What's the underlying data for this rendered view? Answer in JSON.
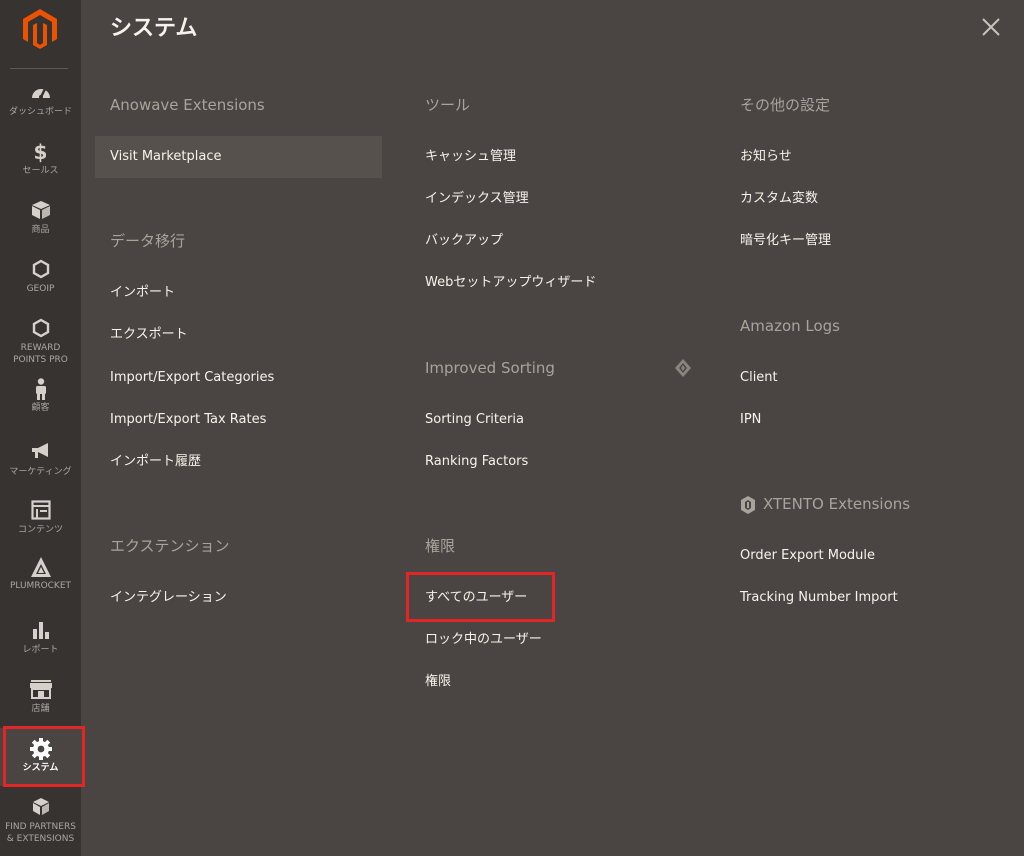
{
  "sidebar": {
    "items": [
      {
        "label": "ダッシュボード",
        "icon": "dashboard-gauge-icon"
      },
      {
        "label": "セールス",
        "icon": "dollar-icon"
      },
      {
        "label": "商品",
        "icon": "cube-icon"
      },
      {
        "label": "GEOIP",
        "icon": "hexagon-icon"
      },
      {
        "label": "REWARD\nPOINTS PRO",
        "icon": "hexagon-icon"
      },
      {
        "label": "顧客",
        "icon": "person-icon"
      },
      {
        "label": "マーケティング",
        "icon": "megaphone-icon"
      },
      {
        "label": "コンテンツ",
        "icon": "layout-icon"
      },
      {
        "label": "PLUMROCKET",
        "icon": "plumrocket-icon"
      },
      {
        "label": "レポート",
        "icon": "bar-chart-icon"
      },
      {
        "label": "店舗",
        "icon": "store-icon"
      },
      {
        "label": "システム",
        "icon": "gear-icon"
      },
      {
        "label": "FIND PARTNERS\n& EXTENSIONS",
        "icon": "boxes-icon"
      }
    ]
  },
  "panel": {
    "title": "システム",
    "close_icon": "close-icon"
  },
  "sections": {
    "anowave": {
      "title": "Anowave Extensions",
      "items": [
        "Visit Marketplace"
      ]
    },
    "data_transfer": {
      "title": "データ移行",
      "items": [
        "インポート",
        "エクスポート",
        "Import/Export Categories",
        "Import/Export Tax Rates",
        "インポート履歴"
      ]
    },
    "extensions": {
      "title": "エクステンション",
      "items": [
        "インテグレーション"
      ]
    },
    "tools": {
      "title": "ツール",
      "items": [
        "キャッシュ管理",
        "インデックス管理",
        "バックアップ",
        "Webセットアップウィザード"
      ]
    },
    "improved_sorting": {
      "title": "Improved Sorting",
      "items": [
        "Sorting Criteria",
        "Ranking Factors"
      ]
    },
    "permissions": {
      "title": "権限",
      "items": [
        "すべてのユーザー",
        "ロック中のユーザー",
        "権限"
      ]
    },
    "other_settings": {
      "title": "その他の設定",
      "items": [
        "お知らせ",
        "カスタム変数",
        "暗号化キー管理"
      ]
    },
    "amazon_logs": {
      "title": "Amazon Logs",
      "items": [
        "Client",
        "IPN"
      ]
    },
    "xtento": {
      "title": "XTENTO Extensions",
      "items": [
        "Order Export Module",
        "Tracking Number Import"
      ]
    }
  },
  "colors": {
    "sidebar_bg": "#373330",
    "panel_bg": "#4a4542",
    "logo_orange": "#eb5202",
    "highlight_red": "#e22626"
  }
}
